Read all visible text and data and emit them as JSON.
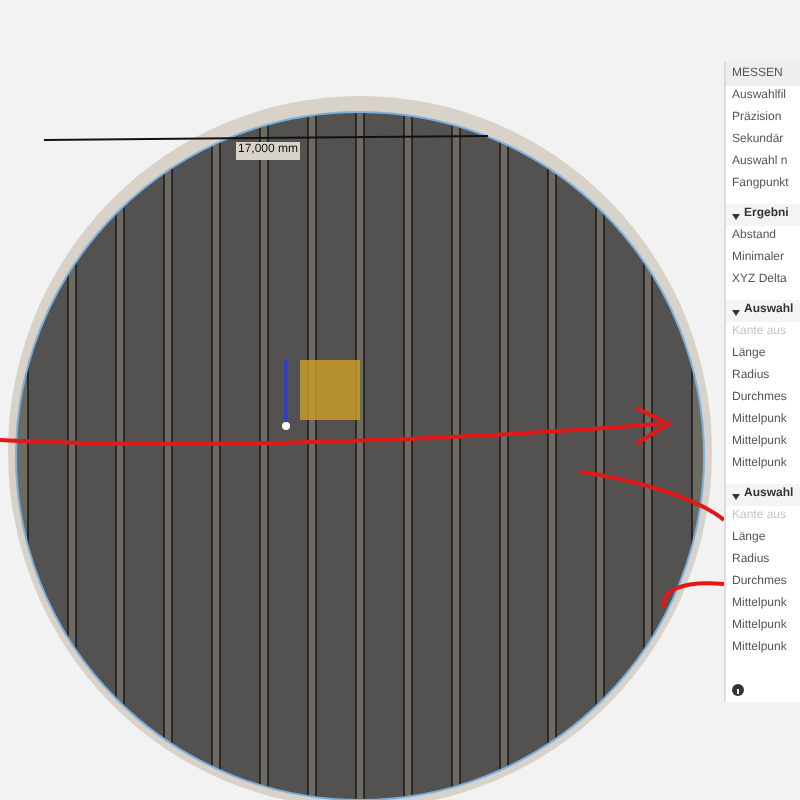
{
  "viewport": {
    "dimension_label": "17,000 mm"
  },
  "panel": {
    "title": "MESSEN",
    "settings": [
      {
        "label": "Auswahlfil",
        "disabled": false
      },
      {
        "label": "Präzision",
        "disabled": false
      },
      {
        "label": "Sekundär",
        "disabled": false
      },
      {
        "label": "Auswahl n",
        "disabled": false
      },
      {
        "label": "Fangpunkt",
        "disabled": false
      }
    ],
    "sections": [
      {
        "title": "Ergebni",
        "expanded": true,
        "rows": [
          {
            "label": "Abstand",
            "disabled": false
          },
          {
            "label": "Minimaler",
            "disabled": false
          },
          {
            "label": "XYZ Delta",
            "disabled": false
          }
        ]
      },
      {
        "title": "Auswahl",
        "expanded": true,
        "rows": [
          {
            "label": "Kante aus",
            "disabled": true
          },
          {
            "label": "Länge",
            "disabled": false
          },
          {
            "label": "Radius",
            "disabled": false
          },
          {
            "label": "Durchmes",
            "disabled": false
          },
          {
            "label": "Mittelpunk",
            "disabled": false
          },
          {
            "label": "Mittelpunk",
            "disabled": false
          },
          {
            "label": "Mittelpunk",
            "disabled": false
          }
        ]
      },
      {
        "title": "Auswahl",
        "expanded": true,
        "rows": [
          {
            "label": "Kante aus",
            "disabled": true
          },
          {
            "label": "Länge",
            "disabled": false
          },
          {
            "label": "Radius",
            "disabled": false
          },
          {
            "label": "Durchmes",
            "disabled": false
          },
          {
            "label": "Mittelpunk",
            "disabled": false
          },
          {
            "label": "Mittelpunk",
            "disabled": false
          },
          {
            "label": "Mittelpunk",
            "disabled": false
          }
        ]
      }
    ]
  }
}
